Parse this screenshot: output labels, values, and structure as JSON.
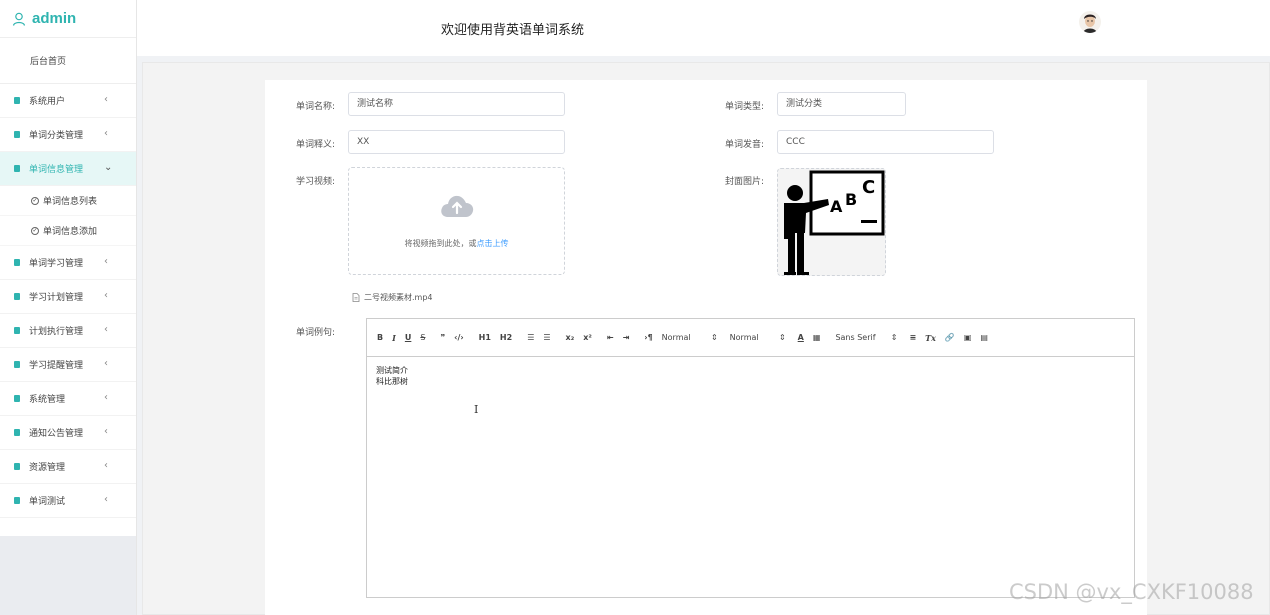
{
  "brand": {
    "title": "admin"
  },
  "header": {
    "title": "欢迎使用背英语单词系统"
  },
  "sidebar": {
    "home": "后台首页",
    "items": [
      {
        "label": "系统用户",
        "expanded": false
      },
      {
        "label": "单词分类管理",
        "expanded": false
      },
      {
        "label": "单词信息管理",
        "expanded": true
      },
      {
        "label": "单词学习管理",
        "expanded": false
      },
      {
        "label": "学习计划管理",
        "expanded": false
      },
      {
        "label": "计划执行管理",
        "expanded": false
      },
      {
        "label": "学习提醒管理",
        "expanded": false
      },
      {
        "label": "系统管理",
        "expanded": false
      },
      {
        "label": "通知公告管理",
        "expanded": false
      },
      {
        "label": "资源管理",
        "expanded": false
      },
      {
        "label": "单词测试",
        "expanded": false
      }
    ],
    "submenu": [
      "单词信息列表",
      "单词信息添加"
    ]
  },
  "form": {
    "name_label": "单词名称:",
    "name_value": "测试名称",
    "type_label": "单词类型:",
    "type_value": "测试分类",
    "meaning_label": "单词释义:",
    "meaning_value": "XX",
    "pron_label": "单词发音:",
    "pron_value": "CCC",
    "video_label": "学习视频:",
    "upload_text": "将视频拖到此处，或",
    "upload_link": "点击上传",
    "cover_label": "封面图片:",
    "file_name": "二号视频素材.mp4",
    "example_label": "单词例句:"
  },
  "editor": {
    "toolbar": {
      "header_select": "Normal",
      "size_select": "Normal",
      "font_select": "Sans Serif",
      "h1": "H1",
      "h2": "H2"
    },
    "content": [
      "测试简介",
      "科比那树"
    ]
  },
  "watermark": "CSDN @vx_CXKF10088",
  "colors": {
    "accent": "#2fb4b0",
    "link": "#409eff"
  }
}
